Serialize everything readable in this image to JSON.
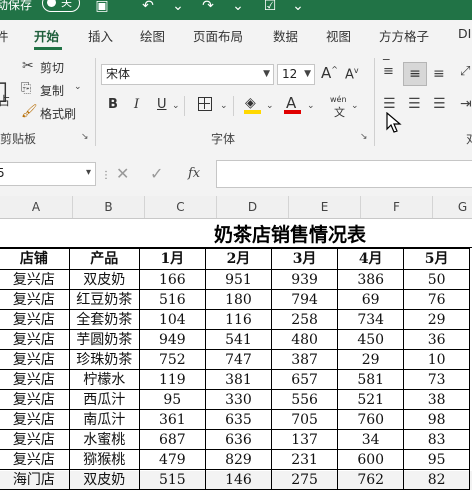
{
  "titlebar": {
    "autosave_label": "动保存",
    "autosave_state": "关"
  },
  "tabs": [
    {
      "label": "件"
    },
    {
      "label": "开始"
    },
    {
      "label": "插入"
    },
    {
      "label": "绘图"
    },
    {
      "label": "页面布局"
    },
    {
      "label": "数据"
    },
    {
      "label": "视图"
    },
    {
      "label": "方方格子"
    },
    {
      "label": "DI"
    }
  ],
  "clipboard": {
    "cut": "剪切",
    "copy": "复制",
    "format_painter": "格式刷",
    "paste_partial": "占",
    "group": "剪贴板"
  },
  "font": {
    "name": "宋体",
    "size": "12",
    "group": "字体",
    "bold": "B",
    "italic": "I",
    "underline": "U",
    "font_color_glyph": "A",
    "phonetic": "wén"
  },
  "formula_bar": {
    "name_box_partial": "5",
    "fx": "fx",
    "value": ""
  },
  "columns": [
    "A",
    "B",
    "C",
    "D",
    "E",
    "F",
    "G"
  ],
  "sheet": {
    "title": "奶茶店销售情况表",
    "headers": [
      "店铺",
      "产品",
      "1月",
      "2月",
      "3月",
      "4月",
      "5月"
    ],
    "rows": [
      [
        "复兴店",
        "双皮奶",
        "166",
        "951",
        "939",
        "386",
        "50"
      ],
      [
        "复兴店",
        "红豆奶茶",
        "516",
        "180",
        "794",
        "69",
        "76"
      ],
      [
        "复兴店",
        "全套奶茶",
        "104",
        "116",
        "258",
        "734",
        "29"
      ],
      [
        "复兴店",
        "芋圆奶茶",
        "949",
        "541",
        "480",
        "450",
        "36"
      ],
      [
        "复兴店",
        "珍珠奶茶",
        "752",
        "747",
        "387",
        "29",
        "10"
      ],
      [
        "复兴店",
        "柠檬水",
        "119",
        "381",
        "657",
        "581",
        "73"
      ],
      [
        "复兴店",
        "西瓜汁",
        "95",
        "330",
        "556",
        "521",
        "38"
      ],
      [
        "复兴店",
        "南瓜汁",
        "361",
        "635",
        "705",
        "760",
        "98"
      ],
      [
        "复兴店",
        "水蜜桃",
        "687",
        "636",
        "137",
        "34",
        "83"
      ],
      [
        "复兴店",
        "猕猴桃",
        "479",
        "829",
        "231",
        "600",
        "95"
      ],
      [
        "海门店",
        "双皮奶",
        "515",
        "146",
        "275",
        "762",
        "82"
      ]
    ]
  },
  "colors": {
    "excel_green": "#217346",
    "highlight_yellow": "#ffd800",
    "font_red": "#e00000"
  }
}
